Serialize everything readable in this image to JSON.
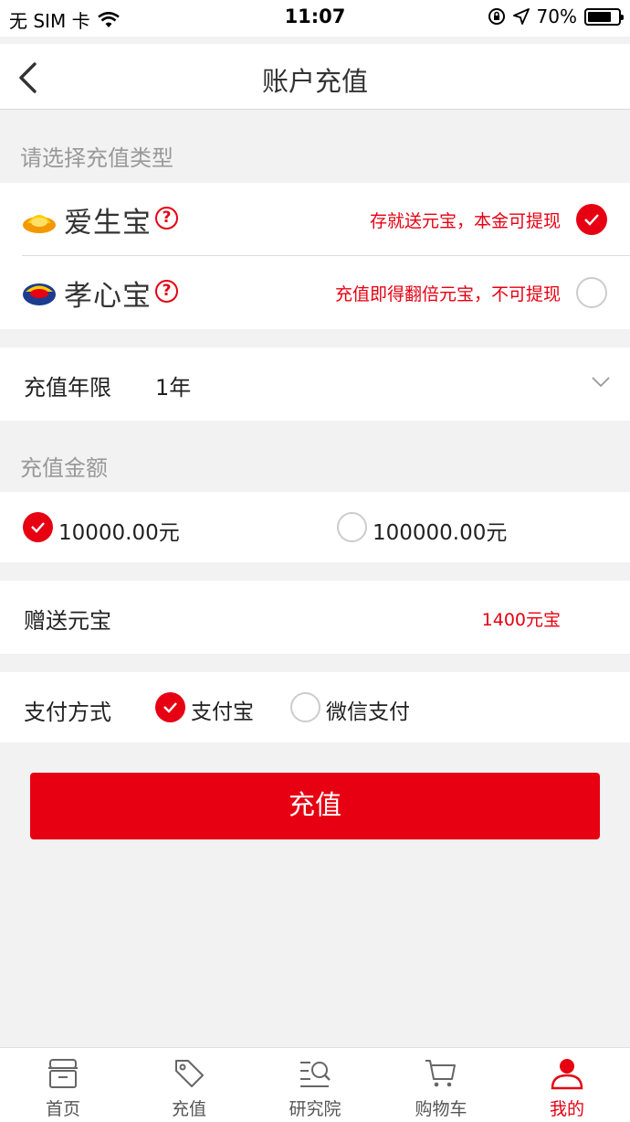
{
  "status_bar": {
    "carrier": "无 SIM 卡",
    "time": "11:07",
    "battery": "70%"
  },
  "nav": {
    "title": "账户充值"
  },
  "recharge_type": {
    "section_label": "请选择充值类型",
    "options": [
      {
        "name": "爱生宝",
        "desc": "存就送元宝，本金可提现",
        "selected": true
      },
      {
        "name": "孝心宝",
        "desc": "充值即得翻倍元宝，不可提现",
        "selected": false
      }
    ]
  },
  "term": {
    "label": "充值年限",
    "value": "1年"
  },
  "amount": {
    "section_label": "充值金额",
    "options": [
      {
        "label": "10000.00元",
        "selected": true
      },
      {
        "label": "100000.00元",
        "selected": false
      }
    ]
  },
  "bonus": {
    "label": "赠送元宝",
    "value": "1400元宝"
  },
  "payment": {
    "label": "支付方式",
    "options": [
      {
        "label": "支付宝",
        "selected": true
      },
      {
        "label": "微信支付",
        "selected": false
      }
    ]
  },
  "submit": {
    "label": "充值"
  },
  "tabbar": {
    "items": [
      {
        "label": "首页",
        "icon": "store-icon",
        "active": false
      },
      {
        "label": "充值",
        "icon": "tag-icon",
        "active": false
      },
      {
        "label": "研究院",
        "icon": "research-icon",
        "active": false
      },
      {
        "label": "购物车",
        "icon": "cart-icon",
        "active": false
      },
      {
        "label": "我的",
        "icon": "user-icon",
        "active": true
      }
    ]
  },
  "colors": {
    "accent": "#e60012",
    "background": "#f2f2f2"
  }
}
